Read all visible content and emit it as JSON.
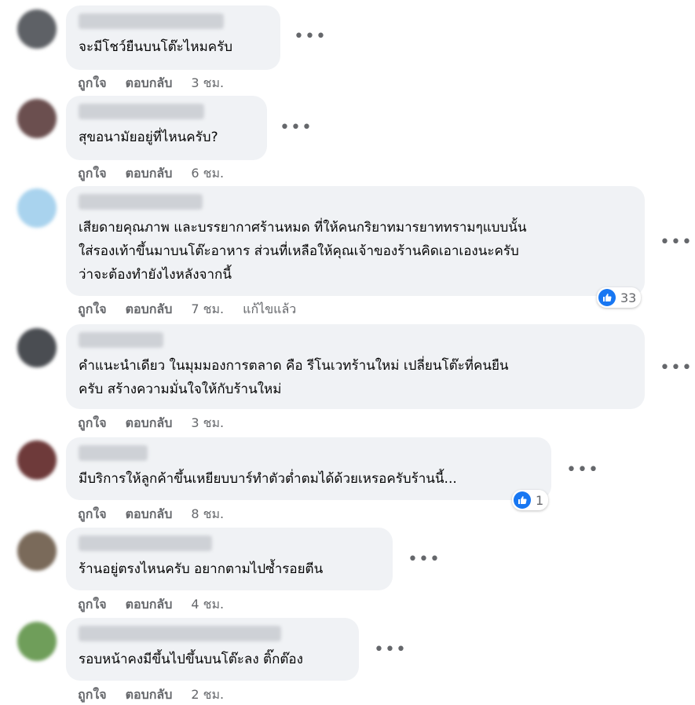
{
  "actions": {
    "like": "ถูกใจ",
    "reply": "ตอบกลับ",
    "edited": "แก้ไขแล้ว"
  },
  "colors": {
    "bubble": "#f0f2f5",
    "meta": "#65676b",
    "like_blue": "#1877f2"
  },
  "comments": [
    {
      "text": "จะมีโชว์ยืนบนโต๊ะไหมครับ",
      "time": "3 ชม."
    },
    {
      "text": "สุขอนามัยอยู่ที่ไหนครับ?",
      "time": "6 ชม."
    },
    {
      "text": "เสียดายคุณภาพ และบรรยากาศร้านหมด ที่ให้คนกริยาทมารยาททรามๆแบบนั้น\nใส่รองเท้าขึ้นมาบนโต๊ะอาหาร ส่วนที่เหลือให้คุณเจ้าของร้านคิดเอาเองนะครับ\nว่าจะต้องทำยังไงหลังจากนี้",
      "time": "7 ชม.",
      "reactions": "33"
    },
    {
      "text": "คำแนะนำเดียว ในมุมมองการตลาด คือ รีโนเวทร้านใหม่ เปลี่ยนโต๊ะที่คนยืน\nครับ สร้างความมั่นใจให้กับร้านใหม่",
      "time": "3 ชม."
    },
    {
      "text": "มีบริการให้ลูกค้าขึ้นเหยียบบาร์ทำตัวต่ำตมได้ด้วยเหรอครับร้านนี้...",
      "time": "8 ชม.",
      "reactions": "1"
    },
    {
      "text": "ร้านอยู่ตรงไหนครับ อยากตามไปซ้ำรอยตีน",
      "time": "4 ชม."
    },
    {
      "text": "รอบหน้าคงมีขึ้นไปขึ้นบนโต๊ะลง ติ๊กต๊อง",
      "time": "2 ชม."
    }
  ]
}
